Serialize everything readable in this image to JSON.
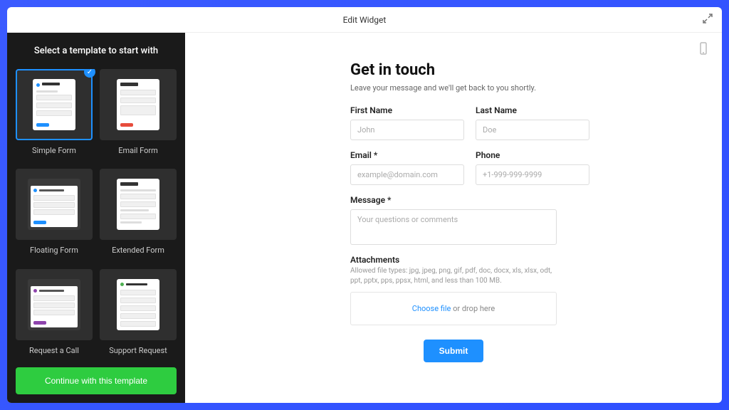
{
  "titlebar": {
    "title": "Edit Widget"
  },
  "sidebar": {
    "heading": "Select a template to start with",
    "templates": [
      {
        "label": "Simple Form",
        "selected": true
      },
      {
        "label": "Email Form"
      },
      {
        "label": "Floating Form"
      },
      {
        "label": "Extended Form"
      },
      {
        "label": "Request a Call"
      },
      {
        "label": "Support Request"
      }
    ],
    "continue_label": "Continue with this template"
  },
  "form": {
    "title": "Get in touch",
    "subtitle": "Leave your message and we'll get back to you shortly.",
    "fields": {
      "first_name": {
        "label": "First Name",
        "placeholder": "John"
      },
      "last_name": {
        "label": "Last Name",
        "placeholder": "Doe"
      },
      "email": {
        "label": "Email *",
        "placeholder": "example@domain.com"
      },
      "phone": {
        "label": "Phone",
        "placeholder": "+1-999-999-9999"
      },
      "message": {
        "label": "Message *",
        "placeholder": "Your questions or comments"
      }
    },
    "attachments": {
      "label": "Attachments",
      "hint": "Allowed file types: jpg, jpeg, png, gif, pdf, doc, docx, xls, xlsx, odt, ppt, pptx, pps, ppsx, html, and less than 100 MB.",
      "choose_text": "Choose file",
      "drop_text": " or drop here"
    },
    "submit_label": "Submit"
  }
}
